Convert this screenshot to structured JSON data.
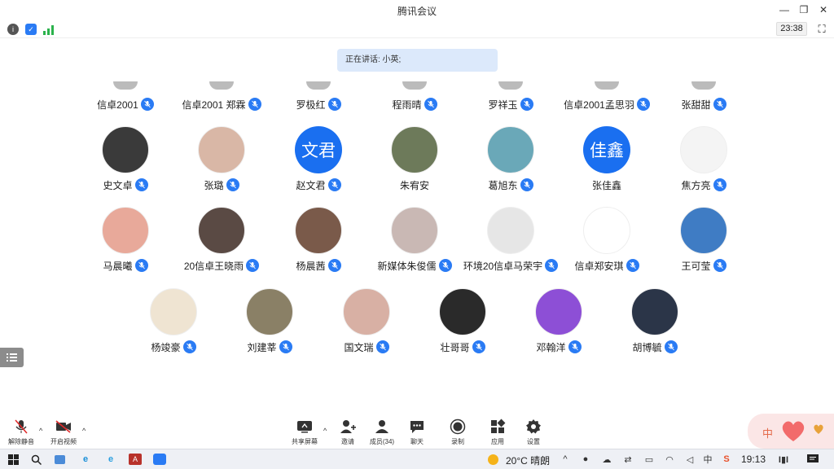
{
  "window": {
    "title": "腾讯会议"
  },
  "infobar": {
    "clock": "23:38"
  },
  "speaking": {
    "label": "正在讲话: 小英;"
  },
  "top_row": [
    {
      "name": "信卓2001"
    },
    {
      "name": "信卓2001 郑霖"
    },
    {
      "name": "罗极红"
    },
    {
      "name": "程雨晴"
    },
    {
      "name": "罗祥玉"
    },
    {
      "name": "信卓2001孟思羽"
    },
    {
      "name": "张甜甜"
    }
  ],
  "participants": [
    {
      "name": "史文卓",
      "avatar": "photo",
      "color": "#3a3a3a",
      "muted": true
    },
    {
      "name": "张璐",
      "avatar": "photo",
      "color": "#d9b7a6",
      "muted": true
    },
    {
      "name": "赵文君",
      "avatar": "text",
      "avatar_text": "文君",
      "muted": true
    },
    {
      "name": "朱宥安",
      "avatar": "photo",
      "color": "#6d7a5a",
      "muted": false
    },
    {
      "name": "葛旭东",
      "avatar": "photo",
      "color": "#6aa8b8",
      "muted": true
    },
    {
      "name": "张佳鑫",
      "avatar": "text",
      "avatar_text": "佳鑫",
      "muted": false
    },
    {
      "name": "焦方亮",
      "avatar": "photo",
      "color": "#f4f4f4",
      "muted": true
    },
    {
      "name": "马晨曦",
      "avatar": "photo",
      "color": "#e8a99a",
      "muted": true
    },
    {
      "name": "20信卓王晓雨",
      "avatar": "photo",
      "color": "#5a4a44",
      "muted": true
    },
    {
      "name": "杨晨茜",
      "avatar": "photo",
      "color": "#7a5a4a",
      "muted": true
    },
    {
      "name": "新媒体朱俊儒",
      "avatar": "photo",
      "color": "#c9b8b4",
      "muted": true
    },
    {
      "name": "环境20信卓马荣宇",
      "avatar": "photo",
      "color": "#e6e6e6",
      "muted": true
    },
    {
      "name": "信卓郑安琪",
      "avatar": "photo",
      "color": "#ffffff",
      "muted": true
    },
    {
      "name": "王可莹",
      "avatar": "photo",
      "color": "#3f7cc4",
      "muted": true
    },
    {
      "name": "杨竣豪",
      "avatar": "photo",
      "color": "#efe4d2",
      "muted": true
    },
    {
      "name": "刘建莘",
      "avatar": "photo",
      "color": "#8a8066",
      "muted": true
    },
    {
      "name": "国文瑞",
      "avatar": "photo",
      "color": "#d8b0a4",
      "muted": true
    },
    {
      "name": "壮哥哥",
      "avatar": "photo",
      "color": "#2a2a2a",
      "muted": true
    },
    {
      "name": "邓翰洋",
      "avatar": "photo",
      "color": "#8d4fd6",
      "muted": true
    },
    {
      "name": "胡博毓",
      "avatar": "photo",
      "color": "#2b3548",
      "muted": true
    }
  ],
  "toolbar": {
    "unmute": "解除静音",
    "start_video": "开启视频",
    "share_screen": "共享屏幕",
    "invite": "邀请",
    "members": "成员(34)",
    "chat": "聊天",
    "record": "录制",
    "apps": "应用",
    "settings": "设置"
  },
  "taskbar": {
    "weather": "20°C 晴朗",
    "time": "19:13",
    "ime": "中"
  }
}
